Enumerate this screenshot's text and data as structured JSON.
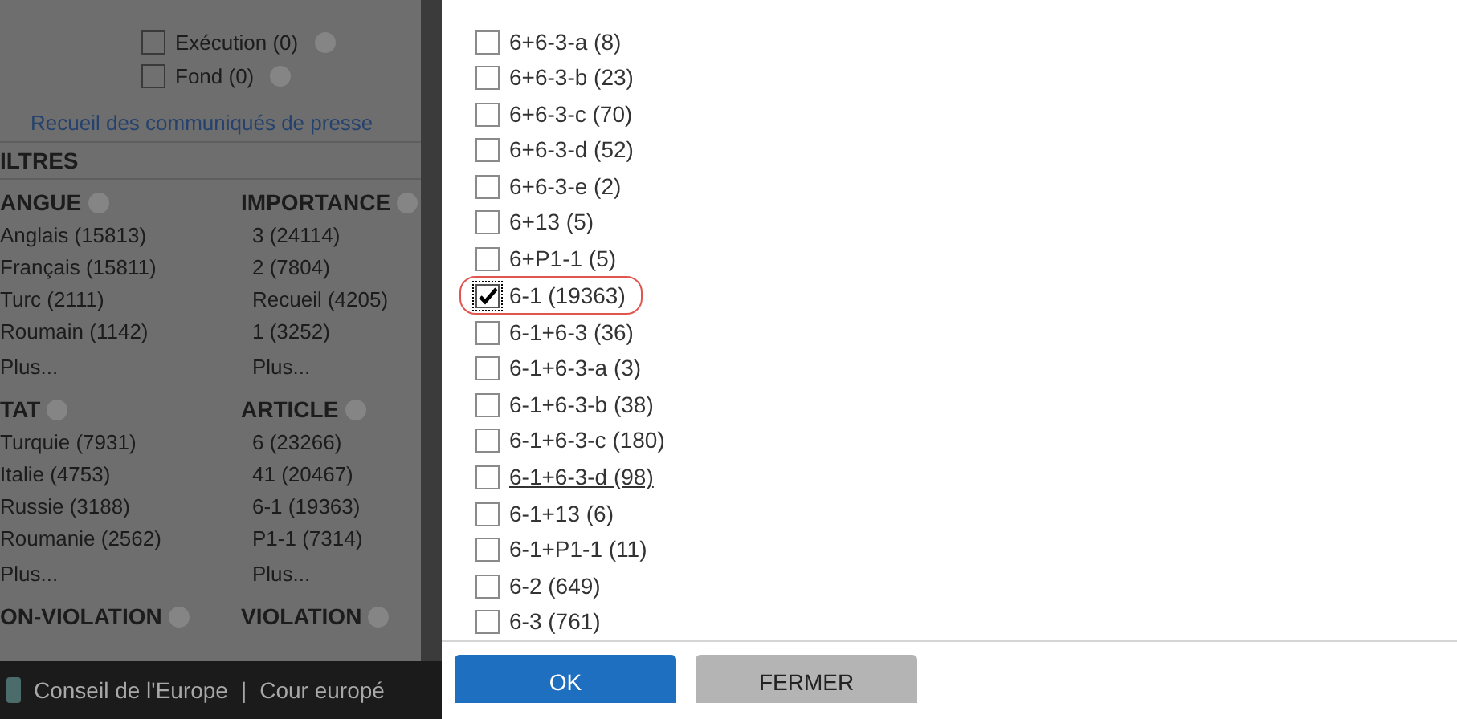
{
  "page": {
    "options": [
      {
        "label": "Exécution (0)",
        "checked": false
      },
      {
        "label": "Fond (0)",
        "checked": false
      }
    ],
    "link": "Recueil des communiqués de presse",
    "filters_title": "ILTRES",
    "facets": [
      [
        {
          "title": "ANGUE",
          "items": [
            "Anglais (15813)",
            "Français (15811)",
            "Turc (2111)",
            "Roumain (1142)"
          ],
          "more": "Plus..."
        },
        {
          "title": "IMPORTANCE",
          "items": [
            "3 (24114)",
            "2 (7804)",
            "Recueil (4205)",
            "1 (3252)"
          ],
          "more": "Plus..."
        }
      ],
      [
        {
          "title": "TAT",
          "items": [
            "Turquie (7931)",
            "Italie (4753)",
            "Russie (3188)",
            "Roumanie (2562)"
          ],
          "more": "Plus..."
        },
        {
          "title": "ARTICLE",
          "items": [
            "6 (23266)",
            "41 (20467)",
            "6-1 (19363)",
            "P1-1 (7314)"
          ],
          "more": "Plus..."
        }
      ],
      [
        {
          "title": "ON-VIOLATION"
        },
        {
          "title": "VIOLATION"
        }
      ]
    ]
  },
  "footer": {
    "links": [
      "Conseil de l'Europe",
      "Cour europé"
    ],
    "separator": "|"
  },
  "dialog": {
    "items": [
      {
        "label": "6+6-3-a (8)",
        "checked": false,
        "hovered": false
      },
      {
        "label": "6+6-3-b (23)",
        "checked": false,
        "hovered": false
      },
      {
        "label": "6+6-3-c (70)",
        "checked": false,
        "hovered": false
      },
      {
        "label": "6+6-3-d (52)",
        "checked": false,
        "hovered": false
      },
      {
        "label": "6+6-3-e (2)",
        "checked": false,
        "hovered": false
      },
      {
        "label": "6+13 (5)",
        "checked": false,
        "hovered": false
      },
      {
        "label": "6+P1-1 (5)",
        "checked": false,
        "hovered": false
      },
      {
        "label": "6-1 (19363)",
        "checked": true,
        "hovered": false
      },
      {
        "label": "6-1+6-3 (36)",
        "checked": false,
        "hovered": false
      },
      {
        "label": "6-1+6-3-a (3)",
        "checked": false,
        "hovered": false
      },
      {
        "label": "6-1+6-3-b (38)",
        "checked": false,
        "hovered": false
      },
      {
        "label": "6-1+6-3-c (180)",
        "checked": false,
        "hovered": false
      },
      {
        "label": "6-1+6-3-d (98)",
        "checked": false,
        "hovered": true
      },
      {
        "label": "6-1+13 (6)",
        "checked": false,
        "hovered": false
      },
      {
        "label": "6-1+P1-1 (11)",
        "checked": false,
        "hovered": false
      },
      {
        "label": "6-2 (649)",
        "checked": false,
        "hovered": false
      },
      {
        "label": "6-3 (761)",
        "checked": false,
        "hovered": false
      }
    ],
    "buttons": [
      {
        "label": "OK",
        "kind": "primary"
      },
      {
        "label": "FERMER",
        "kind": "secondary"
      }
    ]
  }
}
